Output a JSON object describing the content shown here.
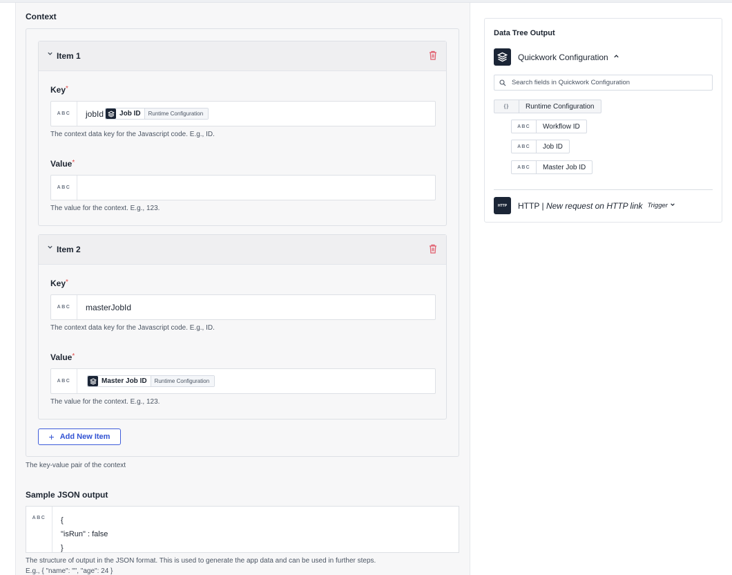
{
  "context": {
    "title": "Context",
    "help": "The key-value pair of the context",
    "add_label": "Add New Item",
    "items": [
      {
        "title": "Item 1",
        "key_label": "Key",
        "key_type": "ABC",
        "key_text": "jobId",
        "key_pill": {
          "name": "Job ID",
          "source": "Runtime Configuration"
        },
        "key_help": "The context data key for the Javascript code. E.g., ID.",
        "value_label": "Value",
        "value_type": "ABC",
        "value_text": "",
        "value_help": "The value for the context. E.g., 123."
      },
      {
        "title": "Item 2",
        "key_label": "Key",
        "key_type": "ABC",
        "key_text": "masterJobId",
        "key_help": "The context data key for the Javascript code. E.g., ID.",
        "value_label": "Value",
        "value_type": "ABC",
        "value_pill": {
          "name": "Master Job ID",
          "source": "Runtime Configuration"
        },
        "value_help": "The value for the context. E.g., 123."
      }
    ]
  },
  "required_marker": "*",
  "sample": {
    "title": "Sample JSON output",
    "type": "ABC",
    "lines": [
      "{",
      "\"isRun\" : false",
      "}"
    ],
    "help": "The structure of output in the JSON format. This is used to generate the app data and can be used in further steps.",
    "example": "E.g., { \"name\": \"\", \"age\": 24 }"
  },
  "data_tree": {
    "title": "Data Tree Output",
    "app_label": "Quickwork Configuration",
    "search_placeholder": "Search fields in Quickwork Configuration",
    "group": {
      "type": "{}",
      "label": "Runtime Configuration"
    },
    "fields": [
      {
        "type": "ABC",
        "label": "Workflow ID"
      },
      {
        "type": "ABC",
        "label": "Job ID"
      },
      {
        "type": "ABC",
        "label": "Master Job ID"
      }
    ],
    "http": {
      "logo": "HTTP",
      "app": "HTTP",
      "separator": "|",
      "event": "New request on HTTP link",
      "trigger": "Trigger"
    }
  },
  "colors": {
    "accent": "#3152d3",
    "required": "#e04848",
    "delete": "#e05a6a",
    "logo_bg": "#1b2536"
  },
  "icons": [
    "chevron-down-icon",
    "trash-icon",
    "layers-icon",
    "plus-icon",
    "search-icon",
    "chevron-up-icon"
  ]
}
